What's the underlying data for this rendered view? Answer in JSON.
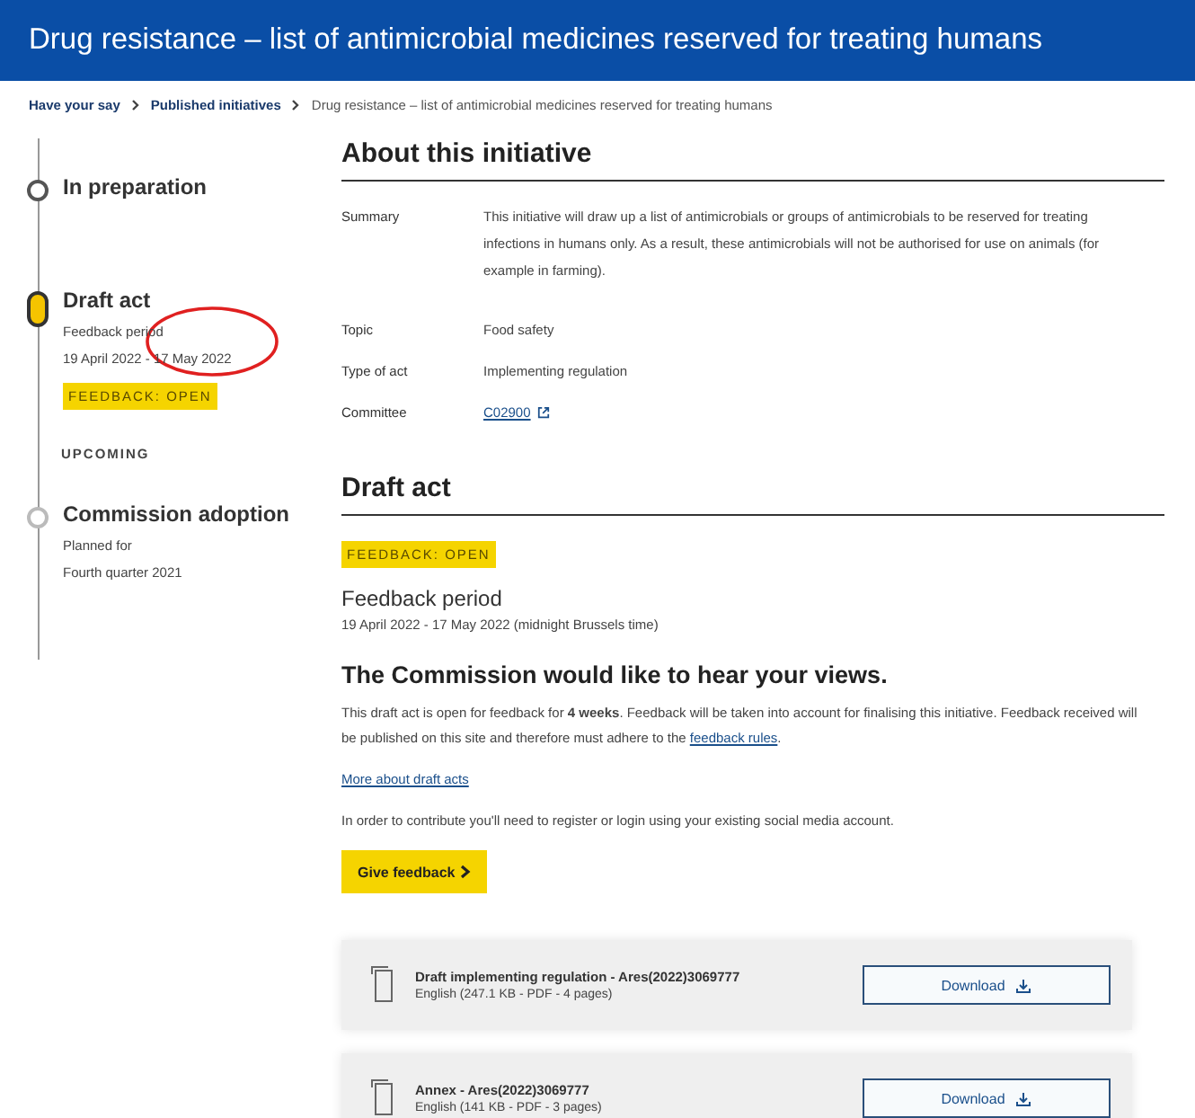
{
  "title": "Drug resistance – list of antimicrobial medicines reserved for treating humans",
  "breadcrumb": [
    {
      "label": "Have your say",
      "kind": "link"
    },
    {
      "label": "Published initiatives",
      "kind": "link"
    },
    {
      "label": "Drug resistance – list of antimicrobial medicines reserved for treating humans",
      "kind": "current"
    }
  ],
  "timeline": [
    {
      "kind": "step",
      "completed": true,
      "current": false,
      "title": "In preparation"
    },
    {
      "kind": "step",
      "completed": false,
      "current": true,
      "title": "Draft act",
      "lines": [
        "Feedback period",
        "19 April 2022 - 17 May 2022"
      ],
      "badge": "FEEDBACK: OPEN"
    },
    {
      "kind": "heading",
      "title": "UPCOMING"
    },
    {
      "kind": "step",
      "completed": false,
      "current": false,
      "title": "Commission adoption",
      "lines": [
        "Planned for",
        "Fourth quarter 2021"
      ]
    }
  ],
  "about": {
    "heading": "About this initiative",
    "rows": [
      {
        "label": "Summary",
        "value": "This initiative will draw up a list of antimicrobials or groups of antimicrobials to be reserved for treating infections in humans only. As a result, these antimicrobials will not be authorised for use on animals (for example in farming).",
        "kind": "text"
      },
      {
        "label": "Topic",
        "value": "Food safety",
        "kind": "text"
      },
      {
        "label": "Type of act",
        "value": "Implementing regulation",
        "kind": "text"
      },
      {
        "label": "Committee",
        "value": "C02900",
        "kind": "link"
      }
    ]
  },
  "draft": {
    "heading": "Draft act",
    "badge": "FEEDBACK: OPEN",
    "period_title": "Feedback period",
    "period": "19 April 2022 - 17 May 2022  (midnight Brussels time)",
    "views_heading": "The Commission would like to hear your views.",
    "intro": "This draft act is open for feedback for **4 weeks**. Feedback will be taken into account for finalising this initiative. Feedback received will be published on this site and therefore must adhere to the",
    "rules_link": "feedback rules",
    "intro_end": ".",
    "more_link": "More about draft acts",
    "register_note": "In order to contribute you'll need to register or login using your existing social media account.",
    "give_button": "Give feedback",
    "documents": [
      {
        "title": "Draft implementing regulation - Ares(2022)3069777",
        "meta": "English (247.1 KB - PDF - 4 pages)",
        "button": "Download"
      },
      {
        "title": "Annex - Ares(2022)3069777",
        "meta": "English (141 KB - PDF - 3 pages)",
        "button": "Download"
      }
    ]
  },
  "annotations": [
    {
      "kind": "ellipse"
    }
  ]
}
